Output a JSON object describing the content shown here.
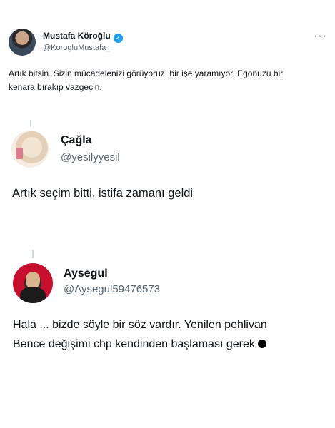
{
  "main_tweet": {
    "author_name": "Mustafa Köroğlu",
    "verified_mark": "✓",
    "author_handle": "@KorogluMustafa_",
    "more_icon": "more-dots-icon",
    "more_label": "···",
    "text_line1": "Artık bitsin. Sizin mücadelenizi görüyoruz, bir işe yaramıyor. Egonuzu bir",
    "text_line2": "kenara bırakıp vazgeçin."
  },
  "replies": [
    {
      "author_name": "Çağla",
      "author_handle": "@yesilyyesil",
      "text_line1": "Artık seçim bitti, istifa zamanı geldi"
    },
    {
      "author_name": "Aysegul",
      "author_handle": "@Aysegul59476573",
      "text_line1": "Hala ... bizde söyle bir söz vardır.  Yenilen pehlivan",
      "text_line2": "Bence değişimi chp kendinden başlaması gerek"
    }
  ],
  "colors": {
    "verified_blue": "#1d9bf0",
    "secondary_text": "#536471",
    "thread_line": "#cfd9de"
  }
}
